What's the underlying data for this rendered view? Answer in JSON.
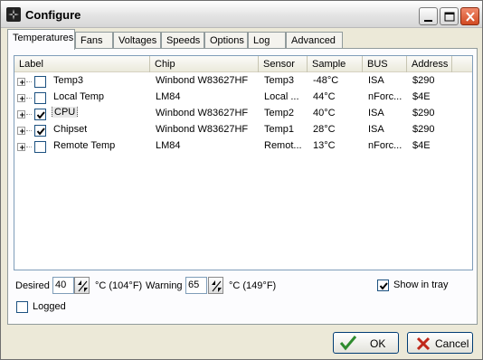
{
  "window": {
    "title": "Configure",
    "icon": "fan-app-icon"
  },
  "title_buttons": {
    "minimize": "minimize-icon",
    "maximize": "maximize-icon",
    "close": "close-icon"
  },
  "tabs": [
    "Temperatures",
    "Fans",
    "Voltages",
    "Speeds",
    "Options",
    "Log",
    "Advanced"
  ],
  "active_tab": "Temperatures",
  "table": {
    "headers": [
      "Label",
      "Chip",
      "Sensor",
      "Sample",
      "BUS",
      "Address"
    ],
    "rows": [
      {
        "label": "Temp3",
        "chip": "Winbond W83627HF",
        "sensor": "Temp3",
        "sample": "-48°C",
        "bus": "ISA",
        "address": "$290",
        "checked": false
      },
      {
        "label": "Local Temp",
        "chip": "LM84",
        "sensor": "Local ...",
        "sample": "44°C",
        "bus": "nForc...",
        "address": "$4E",
        "checked": false
      },
      {
        "label": "CPU",
        "chip": "Winbond W83627HF",
        "sensor": "Temp2",
        "sample": "40°C",
        "bus": "ISA",
        "address": "$290",
        "checked": true
      },
      {
        "label": "Chipset",
        "chip": "Winbond W83627HF",
        "sensor": "Temp1",
        "sample": "28°C",
        "bus": "ISA",
        "address": "$290",
        "checked": true
      },
      {
        "label": "Remote Temp",
        "chip": "LM84",
        "sensor": "Remot...",
        "sample": "13°C",
        "bus": "nForc...",
        "address": "$4E",
        "checked": false
      }
    ]
  },
  "desired": {
    "label": "Desired",
    "value": "40",
    "unit": "°C (104°F)"
  },
  "warning": {
    "label": "Warning",
    "value": "65",
    "unit": "°C (149°F)"
  },
  "show_in_tray": {
    "label": "Show in tray",
    "checked": true
  },
  "logged": {
    "label": "Logged",
    "checked": false
  },
  "buttons": {
    "ok": "OK",
    "cancel": "Cancel"
  },
  "colors": {
    "ok_check": "#2e8b2e",
    "cancel_x": "#c0281a"
  }
}
